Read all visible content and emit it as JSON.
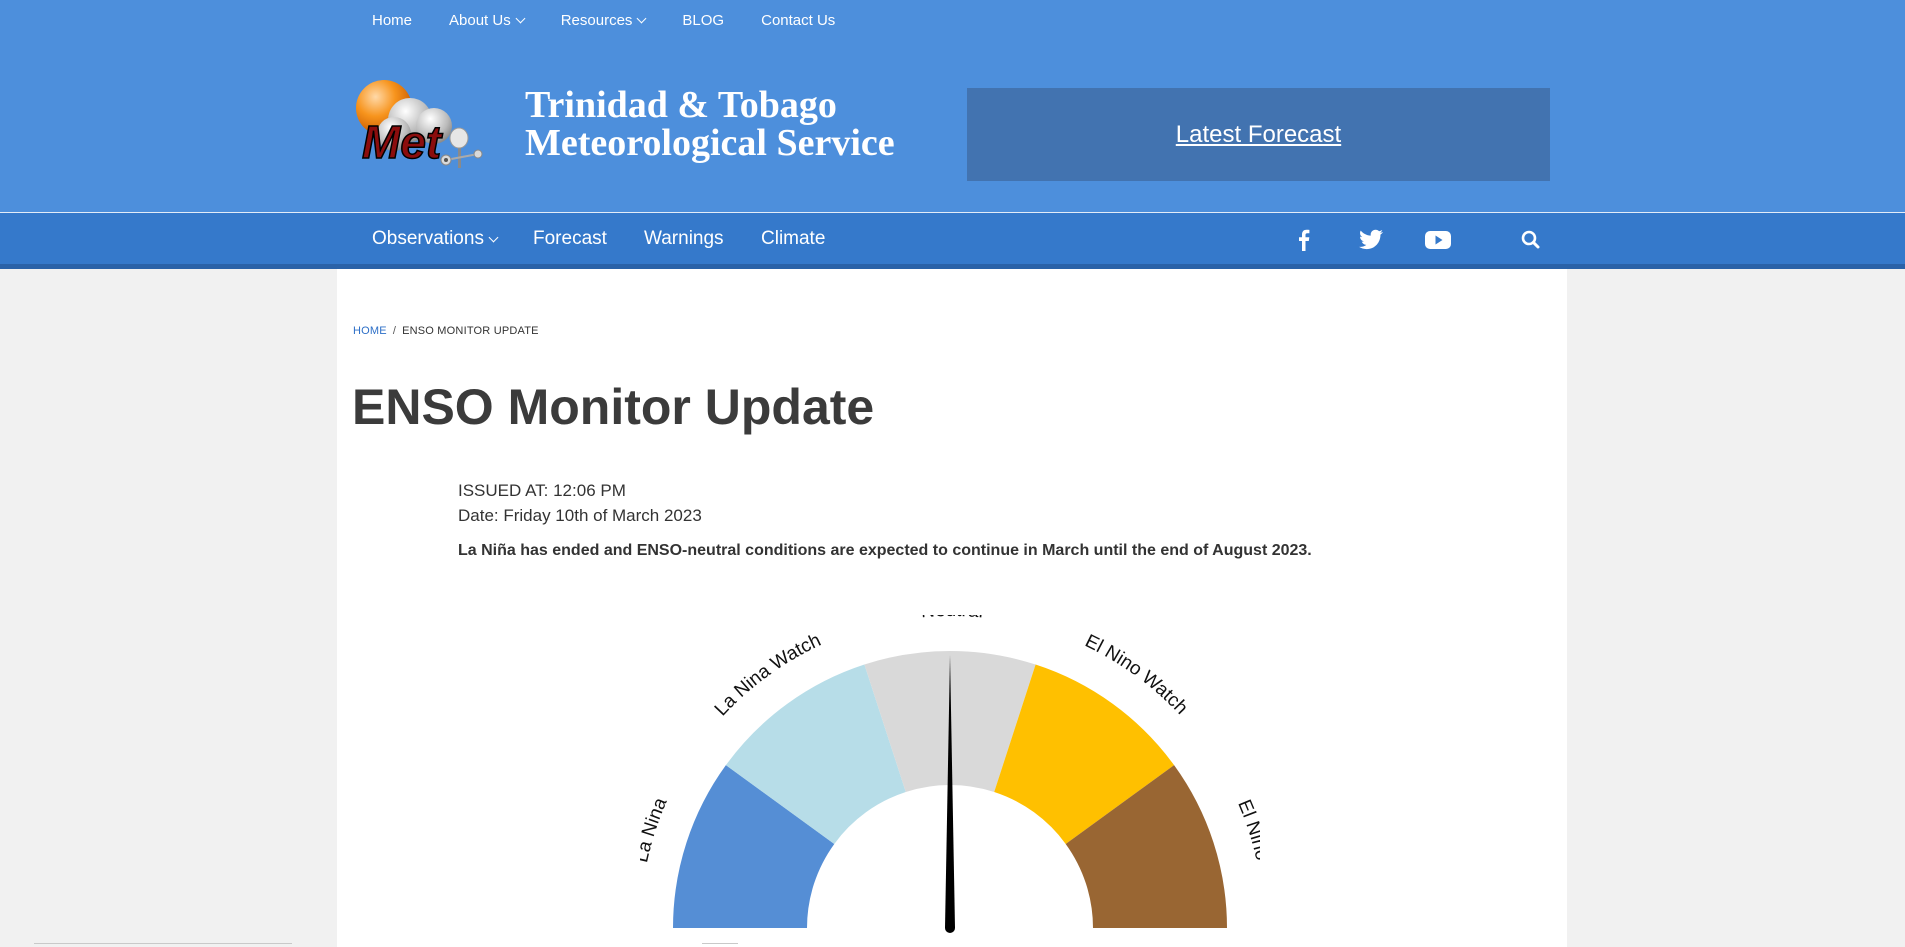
{
  "top_nav": {
    "items": [
      {
        "label": "Home",
        "dropdown": false
      },
      {
        "label": "About Us",
        "dropdown": true
      },
      {
        "label": "Resources",
        "dropdown": true
      },
      {
        "label": "BLOG",
        "dropdown": false
      },
      {
        "label": "Contact Us",
        "dropdown": false
      }
    ]
  },
  "header": {
    "logo_text": "Met",
    "title_line1": "Trinidad & Tobago",
    "title_line2": "Meteorological Service",
    "forecast_link": "Latest Forecast"
  },
  "main_nav": {
    "observations": "Observations",
    "forecast": "Forecast",
    "warnings": "Warnings",
    "climate": "Climate"
  },
  "social": {
    "icons": [
      "facebook-icon",
      "twitter-icon",
      "youtube-icon",
      "search-icon"
    ]
  },
  "breadcrumb": {
    "home": "HOME",
    "separator": "/",
    "current": "ENSO MONITOR UPDATE"
  },
  "page": {
    "title": "ENSO Monitor Update",
    "issued": "ISSUED AT: 12:06 PM",
    "date": "Date: Friday 10th of March 2023",
    "summary": "La Niña has ended and ENSO-neutral conditions are expected to continue in March until the end of August 2023."
  },
  "gauge": {
    "segments": [
      {
        "label": "La Nina",
        "color": "#558ed5"
      },
      {
        "label": "La Nina Watch",
        "color": "#b7dde8"
      },
      {
        "label": "Neutral",
        "color": "#d9d9d9"
      },
      {
        "label": "El Nino Watch",
        "color": "#ffc000"
      },
      {
        "label": "El Nino",
        "color": "#996633"
      }
    ],
    "current_state": "Neutral"
  },
  "colors": {
    "header_bg": "#4d8fdc",
    "nav_bg": "#3579cb",
    "forecast_box": "#4273b0",
    "link_blue": "#2d6fc7"
  }
}
